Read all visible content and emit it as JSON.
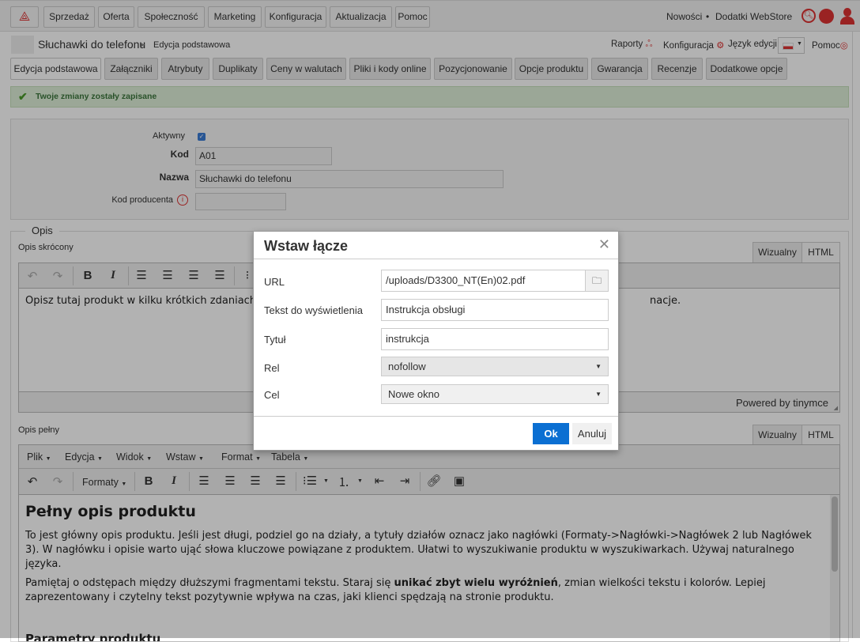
{
  "nav": {
    "items": [
      "Sprzedaż",
      "Oferta",
      "Społeczność",
      "Marketing",
      "Konfiguracja",
      "Aktualizacja",
      "Pomoc"
    ],
    "news": "Nowości",
    "dot": "•",
    "addons": "Dodatki WebStore"
  },
  "breadcrumb": {
    "product": "Słuchawki do telefonu",
    "separator": "►",
    "current": "Edycja podstawowa"
  },
  "header_links": {
    "reports": "Raporty",
    "config": "Konfiguracja",
    "language": "Język edycji",
    "help": "Pomoc"
  },
  "tabs": [
    "Edycja podstawowa",
    "Załączniki",
    "Atrybuty",
    "Duplikaty",
    "Ceny w walutach",
    "Pliki i kody online",
    "Pozycjonowanie",
    "Opcje produktu",
    "Gwarancja",
    "Recenzje",
    "Dodatkowe opcje"
  ],
  "alert": {
    "text": "Twoje zmiany zostały zapisane",
    "color": "#3c763d"
  },
  "form": {
    "active_label": "Aktywny",
    "active_checked": true,
    "code_label": "Kod",
    "code_value": "A01",
    "name_label": "Nazwa",
    "name_value": "Słuchawki do telefonu",
    "mfr_label": "Kod producenta",
    "mfr_value": ""
  },
  "opis": {
    "legend": "Opis",
    "short_label": "Opis skrócony",
    "full_label": "Opis pełny",
    "visual_tab": "Wizualny",
    "html_tab": "HTML",
    "short_text_start": "Opisz tutaj produkt w kilku krótkich zdaniach. W",
    "short_text_end": "nacje.",
    "powered": "Powered by tinymce",
    "menu": [
      "Plik",
      "Edycja",
      "Widok",
      "Wstaw",
      "Format",
      "Tabela"
    ],
    "formats": "Formaty",
    "heading": "Pełny opis produktu",
    "p1": "To jest główny opis produktu. Jeśli jest długi, podziel go na działy, a tytuły działów oznacz jako nagłówki (Formaty->Nagłówki->Nagłówek 2 lub Nagłówek 3). W nagłówku i opisie warto ująć słowa kluczowe powiązane z produktem. Ułatwi to wyszukiwanie produktu w wyszukiwarkach. Używaj naturalnego języka.",
    "p2a": "Pamiętaj o odstępach między dłuższymi fragmentami tekstu. Staraj się ",
    "p2b": "unikać zbyt wielu wyróżnień",
    "p2c": ", zmian wielkości tekstu i kolorów. Lepiej zaprezentowany i czytelny tekst pozytywnie wpływa na czas, jaki klienci spędzają na stronie produktu.",
    "heading2": "Parametry produktu"
  },
  "modal": {
    "title": "Wstaw łącze",
    "url_label": "URL",
    "url_value": "/uploads/D3300_NT(En)02.pdf",
    "text_label": "Tekst do wyświetlenia",
    "text_value": "Instrukcja obsługi",
    "title_label": "Tytuł",
    "title_value": "instrukcja",
    "rel_label": "Rel",
    "rel_value": "nofollow",
    "target_label": "Cel",
    "target_value": "Nowe okno",
    "ok": "Ok",
    "cancel": "Anuluj",
    "ok_color": "#0b6fd2"
  },
  "colors": {
    "brand": "#d32f2f"
  }
}
